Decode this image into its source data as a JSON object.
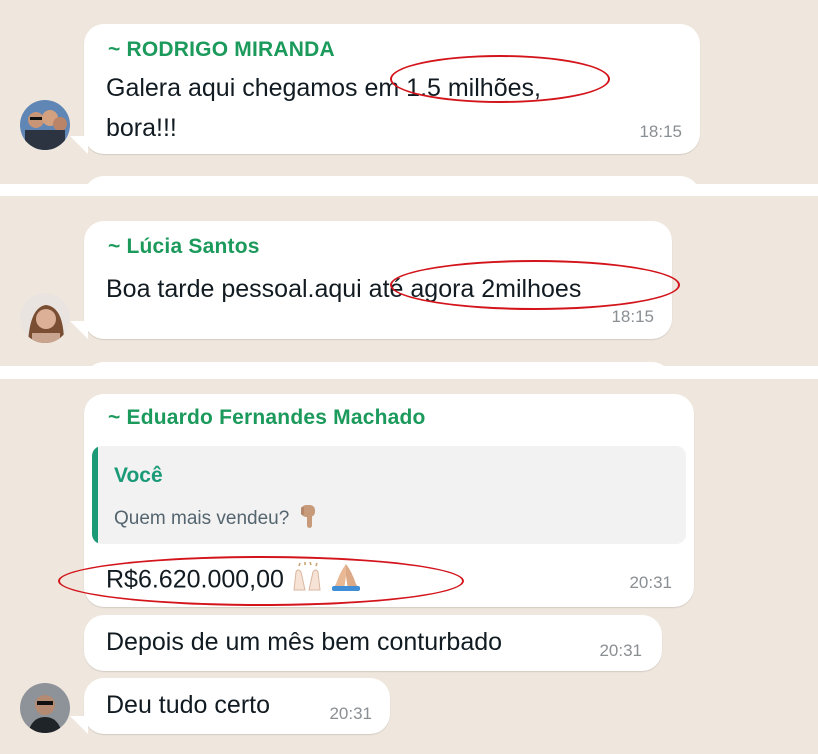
{
  "messages": [
    {
      "sender": "~ RODRIGO MIRANDA",
      "text_line1": "Galera aqui chegamos em 1.5 milhões,",
      "text_line2": "bora!!!",
      "time": "18:15"
    },
    {
      "sender": "~ Lúcia Santos",
      "text": "Boa tarde pessoal.aqui até agora 2milhoes",
      "time": "18:15"
    },
    {
      "sender": "~ Eduardo Fernandes Machado",
      "quote": {
        "author": "Você",
        "text": "Quem mais vendeu?",
        "emoji_icon": "pointing-down-hand-icon"
      },
      "text": "R$6.620.000,00",
      "emoji_icons": [
        "raising-hands-icon",
        "folded-hands-icon"
      ],
      "time": "20:31"
    },
    {
      "text": "Depois de um mês bem conturbado",
      "time": "20:31"
    },
    {
      "text": "Deu tudo certo",
      "time": "20:31"
    }
  ],
  "colors": {
    "chat_background": "#efe7dd",
    "bubble": "#ffffff",
    "sender_name": "#1b9a5c",
    "quote_accent": "#1b9a78",
    "highlight_circle": "#d3141b",
    "timestamp": "#8a8f93"
  }
}
